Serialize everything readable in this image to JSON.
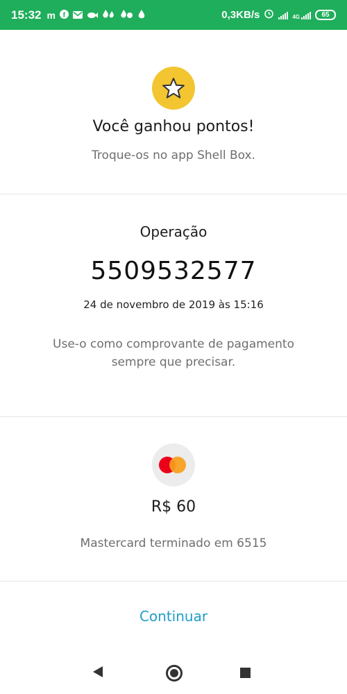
{
  "status_bar": {
    "time": "15:32",
    "notification_icons": [
      "m-icon",
      "facebook-icon",
      "mail-icon",
      "fish-icon",
      "flame-icon",
      "flame-icon",
      "drop-icon"
    ],
    "network_speed": "0,3KB/s",
    "network_type": "4G",
    "battery": "65"
  },
  "points": {
    "title": "Você ganhou pontos!",
    "subtitle": "Troque-os no app Shell Box.",
    "icon": "star-icon",
    "icon_color": "#f2c531"
  },
  "operation": {
    "label": "Operação",
    "number": "5509532577",
    "date": "24 de novembro de 2019 às 15:16",
    "note": "Use-o como comprovante de pagamento sempre que precisar."
  },
  "payment": {
    "icon": "mastercard-icon",
    "amount": "R$ 60",
    "card_description": "Mastercard terminado em 6515"
  },
  "actions": {
    "continue_label": "Continuar",
    "accent_color": "#1f9ec8"
  },
  "colors": {
    "status_bar": "#1fae5b"
  }
}
